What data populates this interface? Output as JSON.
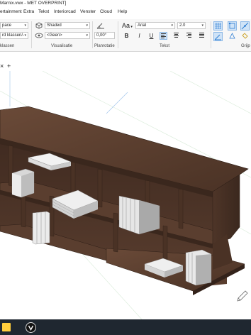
{
  "window": {
    "title": "Marnix.vwx - MET OVERPRINT]"
  },
  "menu": [
    "ertainment",
    "Extra",
    "Tekst",
    "Interiorcad",
    "Venster",
    "Cloud",
    "Help"
  ],
  "ribbon": {
    "class_field": "pace",
    "class_filter_field": "rd klassen/-",
    "render_mode": "Shaded",
    "view_mode": "<Geen>",
    "angle": "0,00°",
    "font_name": "Arial",
    "font_size": "2.0",
    "font_button_label": "Aa",
    "bold_label": "B",
    "italic_label": "I",
    "underline_label": "U",
    "group_labels": {
      "classes": "klassen",
      "visualisation": "Visualisatie",
      "plane": "Planrotatie",
      "text": "Tekst",
      "snap": "Grijp"
    }
  },
  "tabs": {
    "close_label": "×",
    "add_label": "+"
  },
  "colors": {
    "accent": "#2b7cd3",
    "wood": "#5a3e2f",
    "taskbar": "#1f2730"
  },
  "icons": [
    "render-mode-icon",
    "view-icon",
    "angle-icon",
    "bold-icon",
    "italic-icon",
    "underline-icon",
    "align-left-icon",
    "align-center-icon",
    "align-right-icon",
    "justify-icon",
    "snap-grid-icon",
    "snap-object-icon",
    "north-arrow-icon",
    "pen-tool-icon"
  ]
}
